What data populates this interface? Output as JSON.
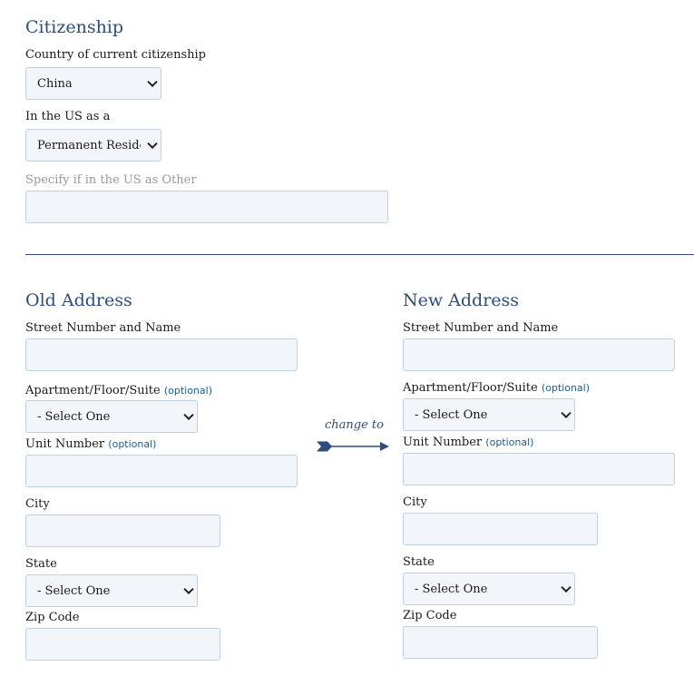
{
  "citizenship": {
    "title": "Citizenship",
    "country_label": "Country of current citizenship",
    "country_value": "China",
    "status_label": "In the US as a",
    "status_value": "Permanent Resident",
    "other_label": "Specify if in the US as Other",
    "other_value": ""
  },
  "arrow": {
    "label": "change to"
  },
  "old_address": {
    "title": "Old Address",
    "street_label": "Street Number and Name",
    "street_value": "",
    "apt_label": "Apartment/Floor/Suite",
    "apt_optional": "(optional)",
    "apt_value": "- Select One",
    "unit_label": "Unit Number",
    "unit_optional": "(optional)",
    "unit_value": "",
    "city_label": "City",
    "city_value": "",
    "state_label": "State",
    "state_value": "- Select One",
    "zip_label": "Zip Code",
    "zip_value": ""
  },
  "new_address": {
    "title": "New Address",
    "street_label": "Street Number and Name",
    "street_value": "",
    "apt_label": "Apartment/Floor/Suite",
    "apt_optional": "(optional)",
    "apt_value": "- Select One",
    "unit_label": "Unit Number",
    "unit_optional": "(optional)",
    "unit_value": "",
    "city_label": "City",
    "city_value": "",
    "state_label": "State",
    "state_value": "- Select One",
    "zip_label": "Zip Code",
    "zip_value": ""
  },
  "colors": {
    "heading": "#2d4e7c",
    "optional_link": "#1d5c8c",
    "field_bg": "#f2f5f9",
    "field_border": "#bfd0e0"
  }
}
